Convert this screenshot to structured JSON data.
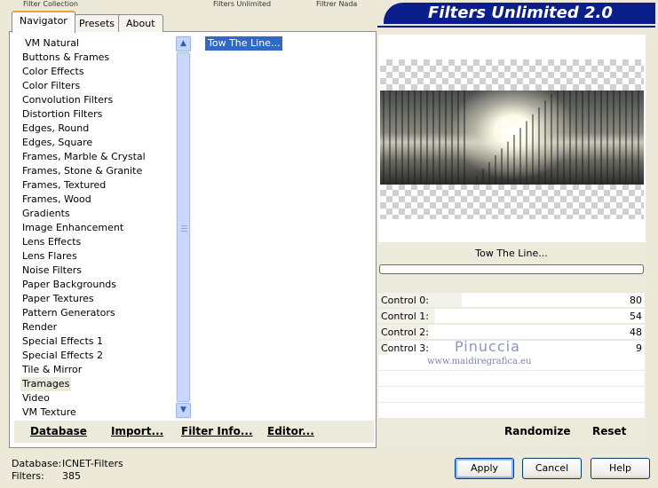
{
  "window": {
    "title": "Filters Unlimited 2.0",
    "truncated_top_texts": [
      "Filter Collection",
      "Filters Unlimited",
      "Filtrer Nada"
    ]
  },
  "tabs": [
    {
      "label": "Navigator",
      "active": true
    },
    {
      "label": "Presets",
      "active": false
    },
    {
      "label": "About",
      "active": false
    }
  ],
  "categories": [
    "VM Natural",
    "Buttons & Frames",
    "Color Effects",
    "Color Filters",
    "Convolution Filters",
    "Distortion Filters",
    "Edges, Round",
    "Edges, Square",
    "Frames, Marble & Crystal",
    "Frames, Stone & Granite",
    "Frames, Textured",
    "Frames, Wood",
    "Gradients",
    "Image Enhancement",
    "Lens Effects",
    "Lens Flares",
    "Noise Filters",
    "Paper Backgrounds",
    "Paper Textures",
    "Pattern Generators",
    "Render",
    "Special Effects 1",
    "Special Effects 2",
    "Tile & Mirror",
    "Tramages",
    "Video",
    "VM Texture"
  ],
  "selected_category": "Tramages",
  "filters": [
    "Tow The Line..."
  ],
  "selected_filter": "Tow The Line...",
  "left_buttons": {
    "database": "Database",
    "import": "Import...",
    "filter_info": "Filter Info...",
    "editor": "Editor..."
  },
  "preview": {
    "filter_name": "Tow The Line...",
    "progress": 0
  },
  "controls": [
    {
      "label": "Control 0:",
      "value": "80",
      "fraction": 0.314
    },
    {
      "label": "Control 1:",
      "value": "54",
      "fraction": 0.212
    },
    {
      "label": "Control 2:",
      "value": "48",
      "fraction": 0.188
    },
    {
      "label": "Control 3:",
      "value": "9",
      "fraction": 0.035
    }
  ],
  "watermark": {
    "name": "Pinuccia",
    "url": "www.maidiregrafica.eu"
  },
  "right_buttons": {
    "randomize": "Randomize",
    "reset": "Reset"
  },
  "status": {
    "database_label": "Database:",
    "database_value": "ICNET-Filters",
    "filters_label": "Filters:",
    "filters_value": "385"
  },
  "dialog_buttons": {
    "apply": "Apply",
    "cancel": "Cancel",
    "help": "Help"
  },
  "colors": {
    "banner": "#0a1e8c",
    "selection": "#316ac5",
    "dialog_face": "#ece9d8"
  }
}
